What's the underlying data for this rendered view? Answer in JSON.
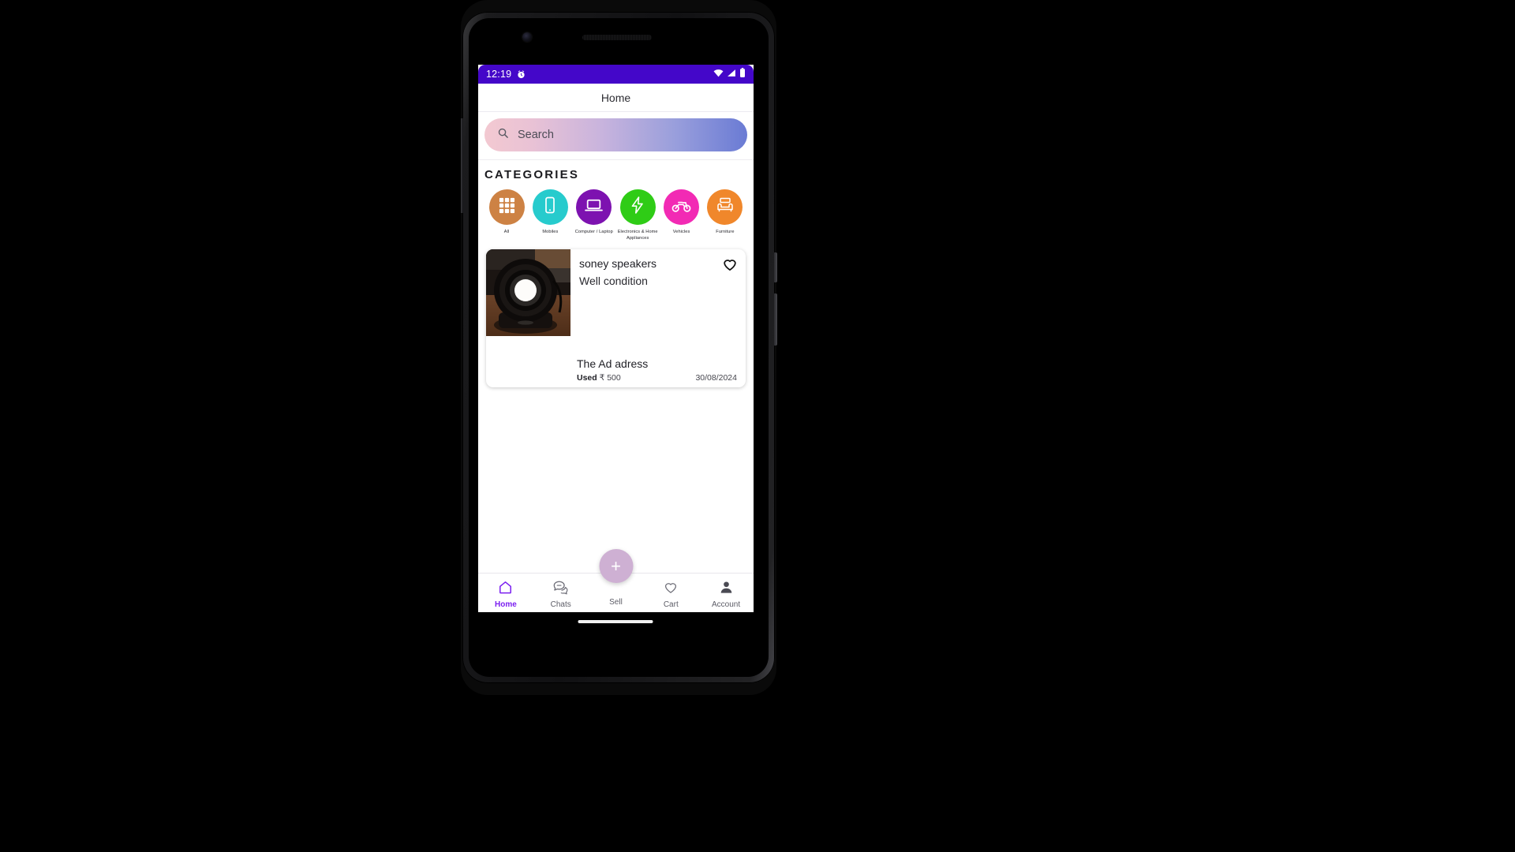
{
  "status_bar": {
    "time": "12:19",
    "icons": [
      "alarm-icon",
      "wifi-icon",
      "signal-icon",
      "battery-icon"
    ],
    "background_color": "#4407c9"
  },
  "app_bar": {
    "title": "Home"
  },
  "search": {
    "placeholder": "Search",
    "icon": "search-icon",
    "gradient_from": "#f3c9d1",
    "gradient_to": "#6a7bd4"
  },
  "categories": {
    "heading": "CATEGORIES",
    "items": [
      {
        "label": "All",
        "icon": "grid-icon",
        "color": "#cd8244"
      },
      {
        "label": "Mobiles",
        "icon": "mobile-phone-icon",
        "color": "#27cbcd"
      },
      {
        "label": "Computer / Laptop",
        "icon": "laptop-icon",
        "color": "#7d12b0"
      },
      {
        "label": "Electronics & Home Appliances",
        "icon": "lightning-bolt-icon",
        "color": "#2fcc16"
      },
      {
        "label": "Vehicles",
        "icon": "motorcycle-icon",
        "color": "#f22ab4"
      },
      {
        "label": "Furniture",
        "icon": "sofa-icon",
        "color": "#f0872b"
      }
    ]
  },
  "listings": [
    {
      "title": "soney speakers",
      "description": "Well condition",
      "address": "The Ad adress",
      "condition": "Used",
      "price": "₹ 500",
      "date": "30/08/2024",
      "favorite_icon": "heart-outline-icon",
      "image": "speaker-photo"
    }
  ],
  "bottom_nav": {
    "active": "Home",
    "items": [
      {
        "label": "Home",
        "icon": "home-icon"
      },
      {
        "label": "Chats",
        "icon": "chat-bubbles-icon"
      },
      {
        "label": "Sell",
        "icon": "plus-icon"
      },
      {
        "label": "Cart",
        "icon": "heart-outline-icon"
      },
      {
        "label": "Account",
        "icon": "person-icon"
      }
    ],
    "fab_label": "+",
    "active_color": "#7b1ff0",
    "fab_color": "#ceb0d3"
  }
}
